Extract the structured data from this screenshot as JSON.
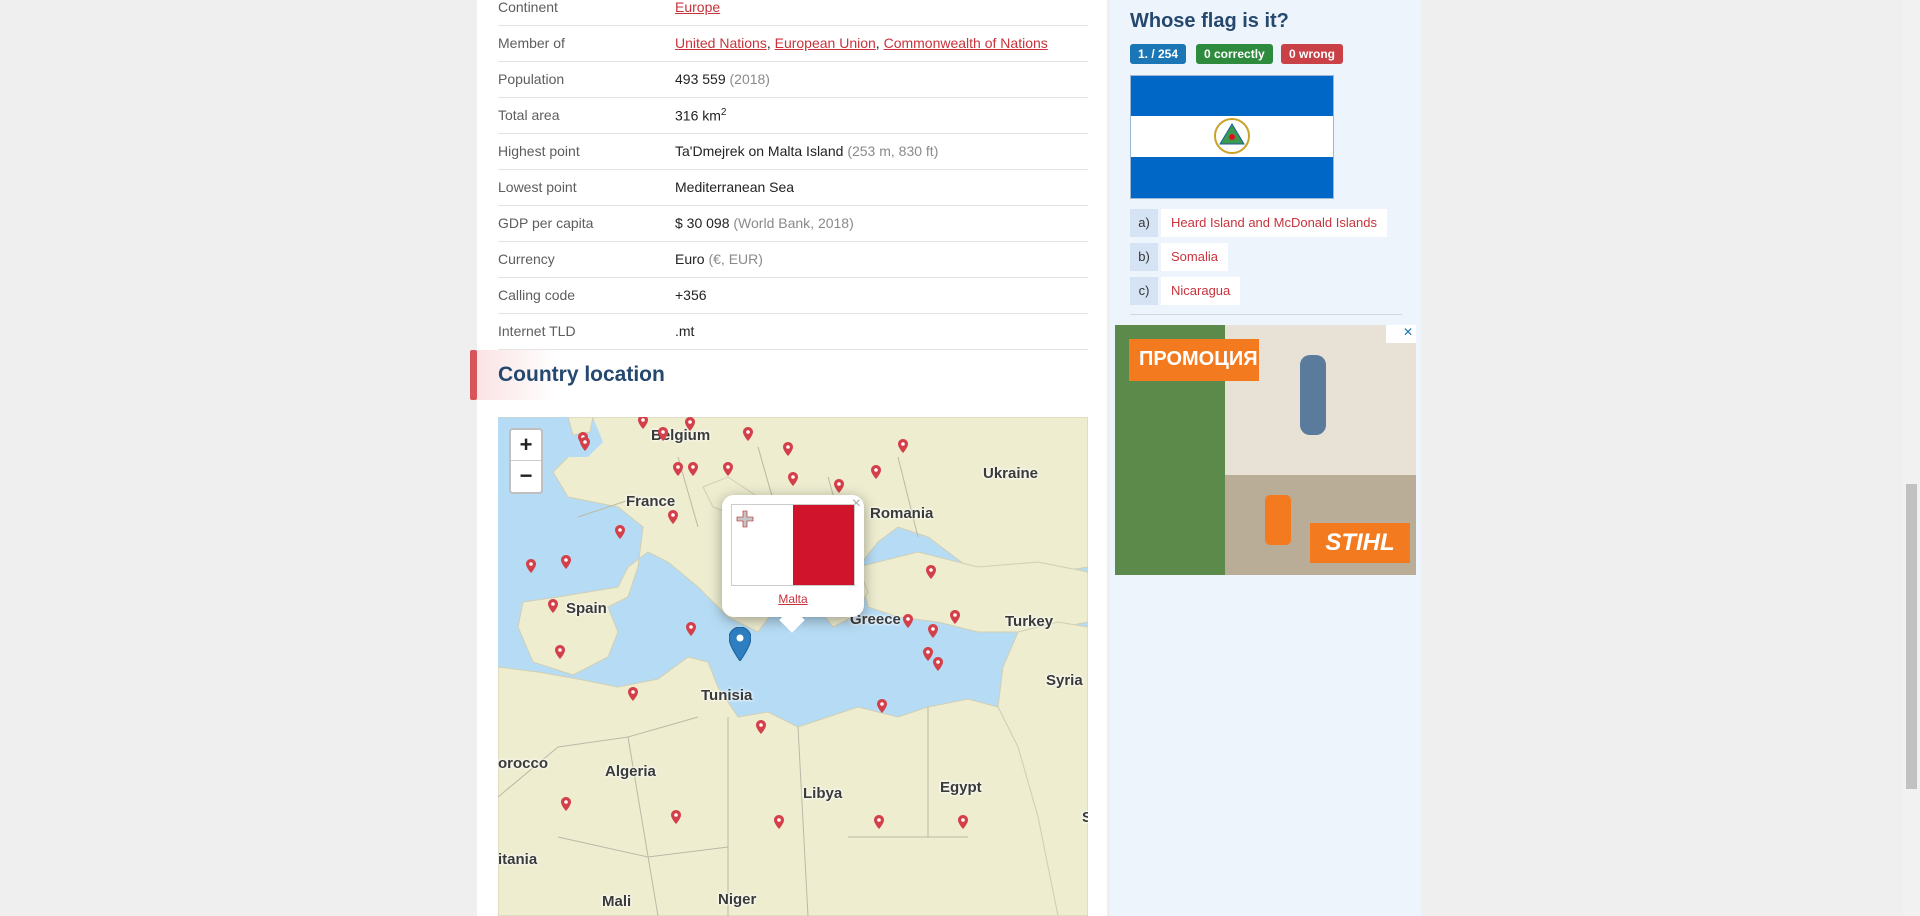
{
  "facts": [
    {
      "label": "Continent",
      "value": "",
      "muted": "",
      "links": [
        "Europe"
      ]
    },
    {
      "label": "Member of",
      "value": "",
      "muted": "",
      "links": [
        "United Nations",
        "European Union",
        "Commonwealth of Nations"
      ]
    },
    {
      "label": "Population",
      "value": "493 559 ",
      "muted": "(2018)",
      "links": []
    },
    {
      "label": "Total area",
      "value": "316 km",
      "sup": "2",
      "muted": "",
      "links": []
    },
    {
      "label": "Highest point",
      "value": "Ta'Dmejrek on Malta Island ",
      "muted": "(253 m, 830 ft)",
      "links": []
    },
    {
      "label": "Lowest point",
      "value": "Mediterranean Sea",
      "muted": "",
      "links": []
    },
    {
      "label": "GDP per capita",
      "value": "$ 30 098 ",
      "muted": "(World Bank, 2018)",
      "links": []
    },
    {
      "label": "Currency",
      "value": "Euro ",
      "muted": "(€, EUR)",
      "links": []
    },
    {
      "label": "Calling code",
      "value": "+356",
      "muted": "",
      "links": []
    },
    {
      "label": "Internet TLD",
      "value": ".mt",
      "muted": "",
      "links": []
    }
  ],
  "location": {
    "title": "Country location"
  },
  "map": {
    "zoom_in": "+",
    "zoom_out": "−",
    "labels": [
      "Belgium",
      "France",
      "Ukraine",
      "Romania",
      "Spain",
      "Greece",
      "Turkey",
      "Tunisia",
      "Syria",
      "orocco",
      "Algeria",
      "Libya",
      "Egypt",
      "itania",
      "Mali",
      "Niger",
      "S"
    ],
    "popup": {
      "country": "Malta",
      "close": "×"
    }
  },
  "quiz": {
    "title": "Whose flag is it?",
    "counter": "1. / 254",
    "correct": "0 correctly",
    "wrong": "0 wrong",
    "answers": [
      {
        "letter": "a)",
        "text": "Heard Island and McDonald Islands"
      },
      {
        "letter": "b)",
        "text": "Somalia"
      },
      {
        "letter": "c)",
        "text": "Nicaragua"
      }
    ]
  },
  "ad": {
    "promo": "ПРОМОЦИЯ",
    "brand": "STIHL",
    "close": "✕"
  },
  "colors": {
    "accent": "#c8333c",
    "heading": "#24486e",
    "badge_blue": "#1a76b4",
    "badge_green": "#2e8b3e",
    "badge_red": "#c94046",
    "water": "#b6dcf5",
    "land": "#eeedd0"
  }
}
